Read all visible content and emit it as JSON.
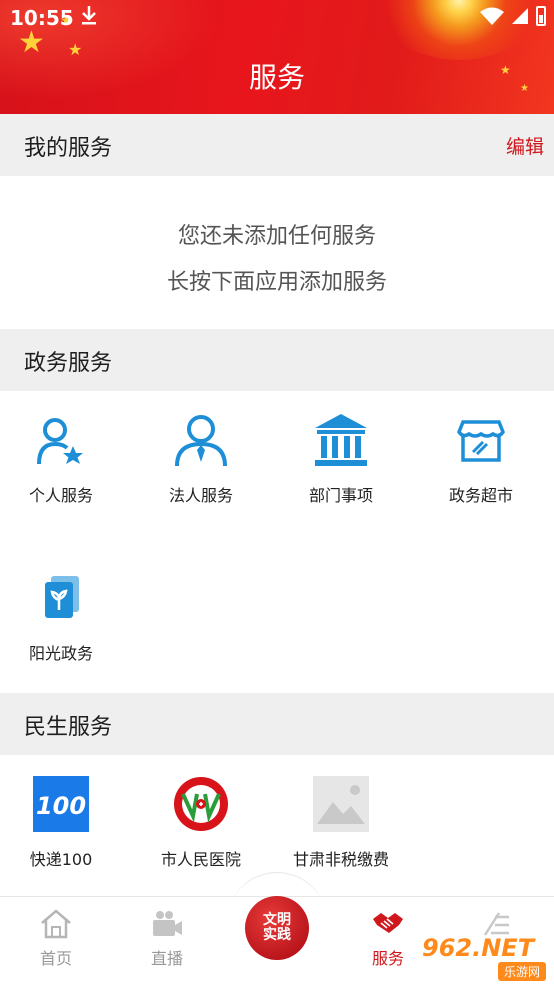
{
  "status_bar": {
    "time": "10:55"
  },
  "header": {
    "title": "服务"
  },
  "my_services": {
    "title": "我的服务",
    "edit_label": "编辑",
    "empty_line1": "您还未添加任何服务",
    "empty_line2": "长按下面应用添加服务"
  },
  "gov_services": {
    "title": "政务服务",
    "items": [
      {
        "label": "个人服务",
        "icon": "person-star-icon"
      },
      {
        "label": "法人服务",
        "icon": "businessman-icon"
      },
      {
        "label": "部门事项",
        "icon": "government-building-icon"
      },
      {
        "label": "政务超市",
        "icon": "storefront-icon"
      },
      {
        "label": "阳光政务",
        "icon": "sprout-book-icon"
      }
    ]
  },
  "livelihood_services": {
    "title": "民生服务",
    "items": [
      {
        "label": "快递100",
        "icon": "kuaidi100-logo"
      },
      {
        "label": "市人民医院",
        "icon": "hospital-logo"
      },
      {
        "label": "甘肃非税缴费",
        "icon": "image-placeholder-icon"
      }
    ]
  },
  "bottom_nav": {
    "items": [
      {
        "label": "首页",
        "icon": "home-icon",
        "active": false
      },
      {
        "label": "直播",
        "icon": "video-camera-icon",
        "active": false
      },
      {
        "label": "文明实践",
        "icon": "civilization-practice-badge",
        "active": false
      },
      {
        "label": "服务",
        "icon": "handshake-icon",
        "active": true
      }
    ],
    "center_badge_line1": "文明",
    "center_badge_line2": "实践"
  },
  "watermark": {
    "main": "962.NET",
    "sub": "乐游网"
  },
  "colors": {
    "accent_red": "#d0171c",
    "icon_blue": "#1e8fd6",
    "section_bg": "#efefef"
  }
}
